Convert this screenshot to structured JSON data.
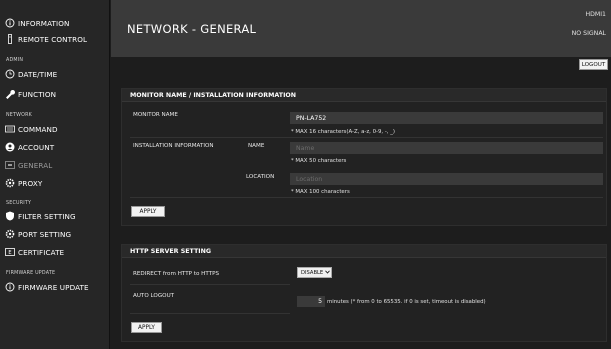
{
  "sidebar": {
    "information": "INFORMATION",
    "remote_control": "REMOTE CONTROL",
    "admin_section": "ADMIN",
    "date_time": "DATE/TIME",
    "function": "FUNCTION",
    "network_section": "NETWORK",
    "command": "COMMAND",
    "account": "ACCOUNT",
    "general": "GENERAL",
    "proxy": "PROXY",
    "security_section": "SECURITY",
    "filter_setting": "FILTER SETTING",
    "port_setting": "PORT SETTING",
    "certificate": "CERTIFICATE",
    "firmware_section": "FIRMWARE UPDATE",
    "firmware_update": "FIRMWARE UPDATE"
  },
  "header": {
    "title": "NETWORK - GENERAL",
    "input_source": "HDMI1",
    "signal_status": "NO SIGNAL"
  },
  "logout_label": "LOGOUT",
  "monitor_panel": {
    "title": "MONITOR NAME / INSTALLATION INFORMATION",
    "monitor_name_label": "MONITOR NAME",
    "monitor_name_value": "PN-LA752",
    "monitor_name_hint": "* MAX 16 characters(A-Z, a-z, 0-9, -, _)",
    "installation_label": "INSTALLATION INFORMATION",
    "name_label": "NAME",
    "name_placeholder": "Name",
    "name_hint": "* MAX 50 characters",
    "location_label": "LOCATION",
    "location_placeholder": "Location",
    "location_hint": "* MAX 100 characters",
    "apply_label": "APPLY"
  },
  "http_panel": {
    "title": "HTTP SERVER SETTING",
    "redirect_label": "REDIRECT from HTTP to HTTPS",
    "redirect_value": "DISABLE",
    "autologout_label": "AUTO LOGOUT",
    "autologout_value": "5",
    "autologout_hint": "minutes (* from 0 to 65535. if 0 is set, timeout is disabled)",
    "apply_label": "APPLY"
  }
}
